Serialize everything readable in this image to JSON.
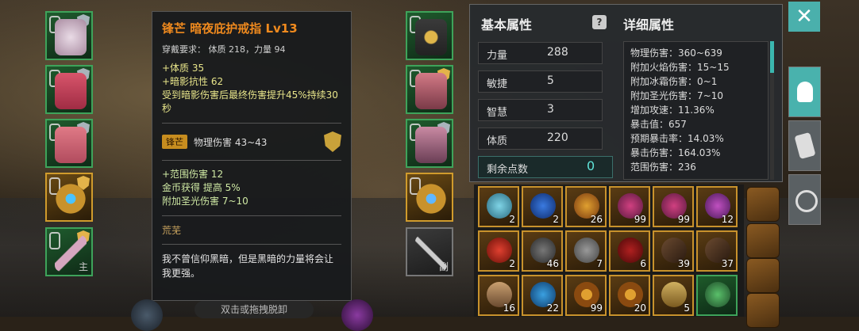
{
  "tooltip": {
    "title": "锋芒 暗夜庇护戒指 Lv13",
    "requirement": "穿戴要求： 体质 218，力量 94",
    "attrs": [
      "+体质 35",
      "+暗影抗性 62",
      "受到暗影伤害后最终伤害提升45%持续30秒"
    ],
    "enchant_tag": "锋芒",
    "enchant_text": "物理伤害 43~43",
    "bonus": [
      "+范围伤害 12",
      "金币获得 提高 5%",
      "附加圣光伤害 7~10"
    ],
    "origin": "荒芜",
    "quote": "我不曾信仰黑暗，但是黑暗的力量将会让我更强。"
  },
  "equipment": {
    "left_tag": "主",
    "right_tag": "副"
  },
  "stats_panel": {
    "basic_header": "基本属性",
    "detail_header": "详细属性",
    "basic": [
      {
        "label": "力量",
        "value": "288"
      },
      {
        "label": "敏捷",
        "value": "5"
      },
      {
        "label": "智慧",
        "value": "3"
      },
      {
        "label": "体质",
        "value": "220"
      }
    ],
    "free_points_label": "剩余点数",
    "free_points_value": "0",
    "details": [
      "物理伤害：360~639",
      "附加火焰伤害：15~15",
      "附加冰霜伤害：0~1",
      "附加圣光伤害：7~10",
      "增加攻速：11.36%",
      "暴击值：657",
      "预期暴击率：14.03%",
      "暴击伤害：164.03%",
      "范围伤害：236"
    ]
  },
  "inventory": {
    "counts": [
      "2",
      "2",
      "26",
      "99",
      "99",
      "12",
      "2",
      "46",
      "7",
      "6",
      "39",
      "37",
      "16",
      "22",
      "99",
      "20",
      "5",
      ""
    ]
  },
  "bottom_hint": "双击或拖拽脱卸",
  "colors": {
    "accent": "#4ab0ac",
    "title_orange": "#f08a1e",
    "slot_green": "#3ea35a",
    "slot_gold": "#d09b2c"
  }
}
